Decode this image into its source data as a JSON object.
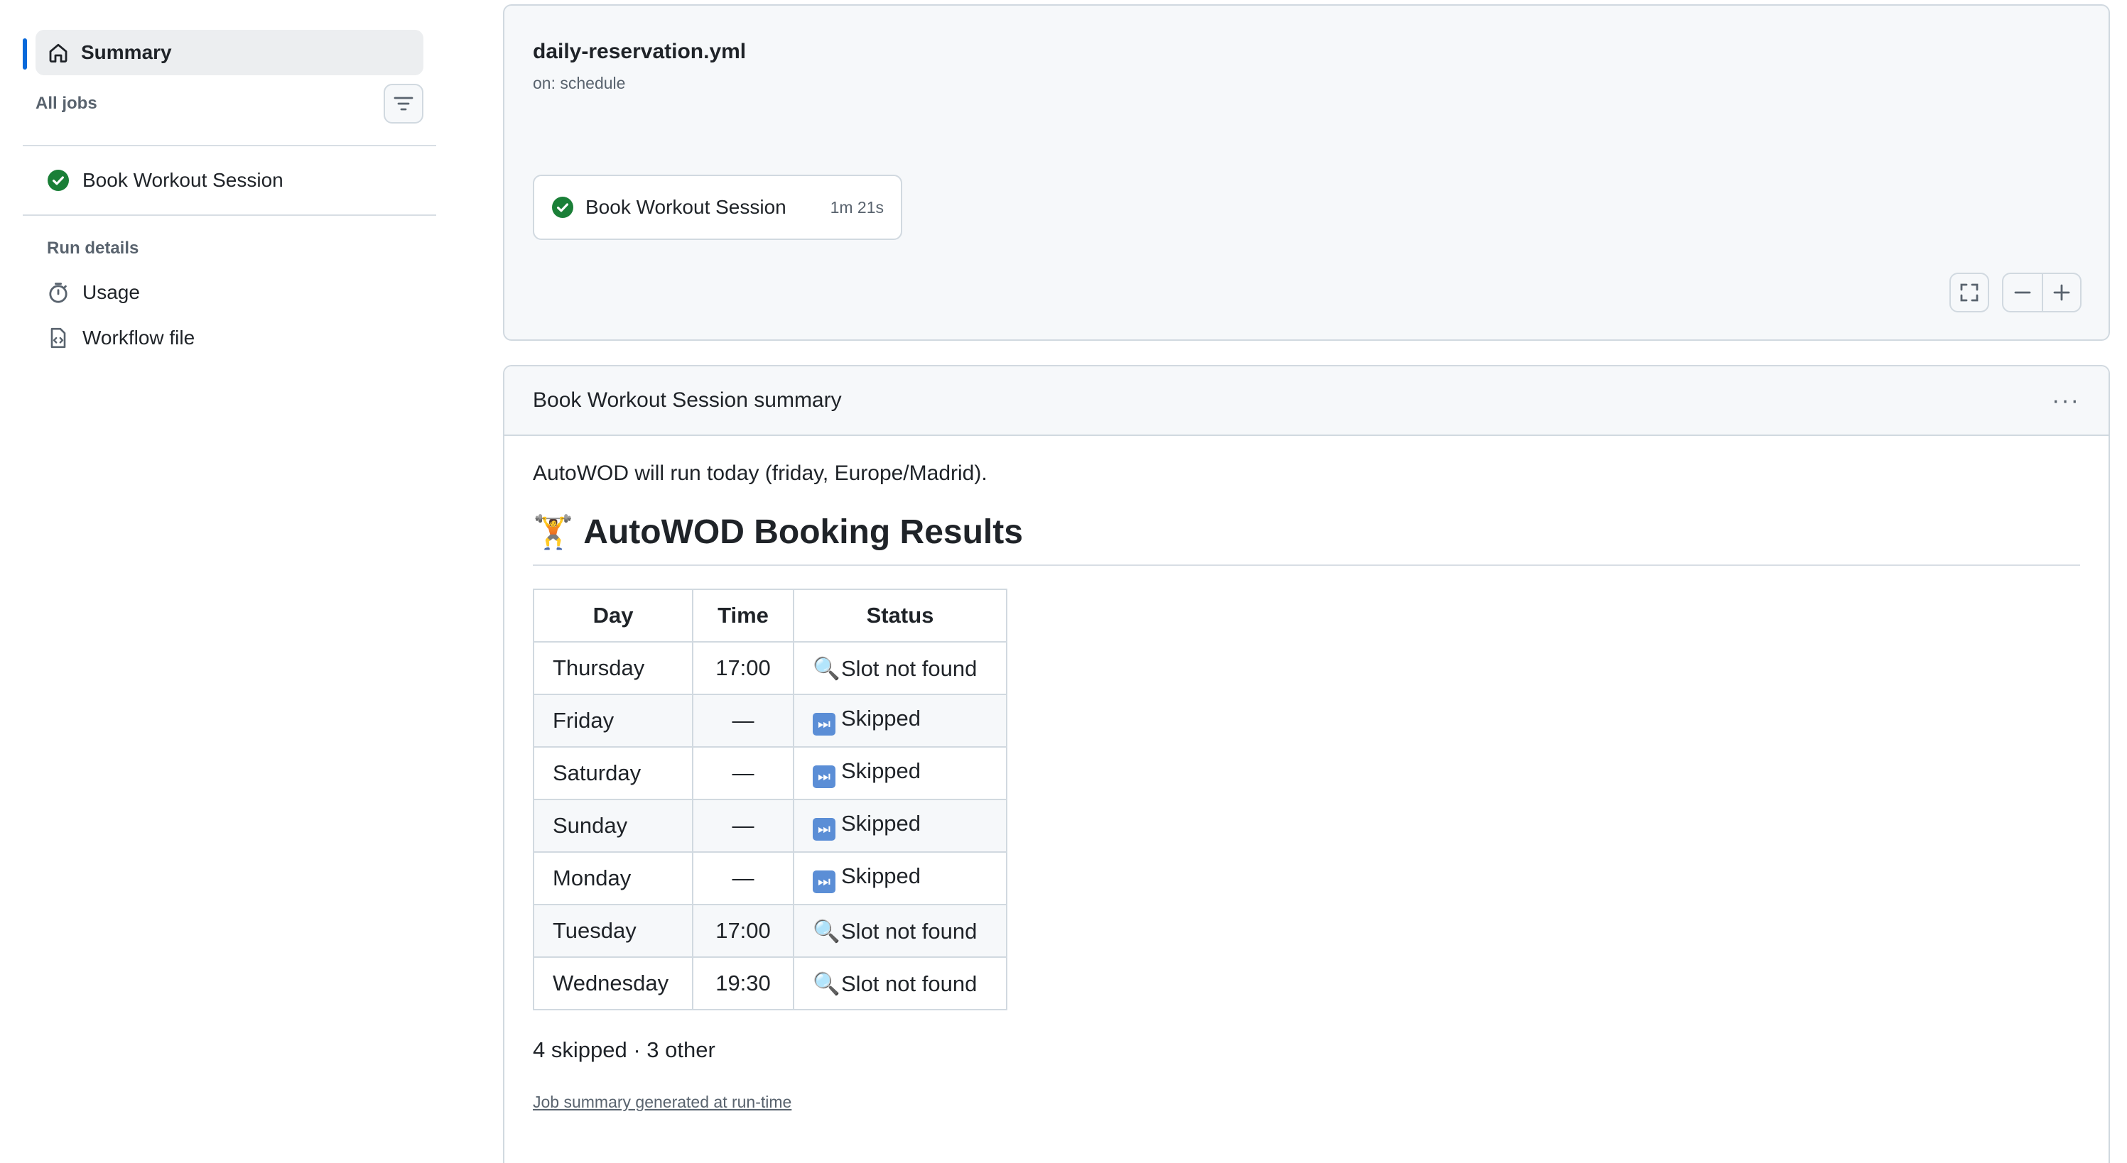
{
  "sidebar": {
    "summary_label": "Summary",
    "all_jobs_label": "All jobs",
    "jobs": [
      {
        "label": "Book Workout Session"
      }
    ],
    "run_details_label": "Run details",
    "details": [
      {
        "label": "Usage"
      },
      {
        "label": "Workflow file"
      }
    ]
  },
  "workflow": {
    "file": "daily-reservation.yml",
    "trigger": "on: schedule",
    "job": {
      "name": "Book Workout Session",
      "duration": "1m 21s"
    }
  },
  "summary": {
    "title": "Book Workout Session summary",
    "intro": "AutoWOD will run today (friday, Europe/Madrid).",
    "heading": "AutoWOD Booking Results",
    "heading_emoji": "🏋️",
    "table": {
      "headers": [
        "Day",
        "Time",
        "Status"
      ],
      "rows": [
        {
          "day": "Thursday",
          "time": "17:00",
          "status": "Slot not found",
          "icon": "magnifier-icon"
        },
        {
          "day": "Friday",
          "time": "—",
          "status": "Skipped",
          "icon": "skip-icon"
        },
        {
          "day": "Saturday",
          "time": "—",
          "status": "Skipped",
          "icon": "skip-icon"
        },
        {
          "day": "Sunday",
          "time": "—",
          "status": "Skipped",
          "icon": "skip-icon"
        },
        {
          "day": "Monday",
          "time": "—",
          "status": "Skipped",
          "icon": "skip-icon"
        },
        {
          "day": "Tuesday",
          "time": "17:00",
          "status": "Slot not found",
          "icon": "magnifier-icon"
        },
        {
          "day": "Wednesday",
          "time": "19:30",
          "status": "Slot not found",
          "icon": "magnifier-icon"
        }
      ]
    },
    "counts": "4 skipped · 3 other",
    "footer": "Job summary generated at run-time"
  },
  "colors": {
    "accent": "#0969da",
    "success": "#1a7f37",
    "border": "#d1d9e0",
    "muted": "#59636e"
  }
}
